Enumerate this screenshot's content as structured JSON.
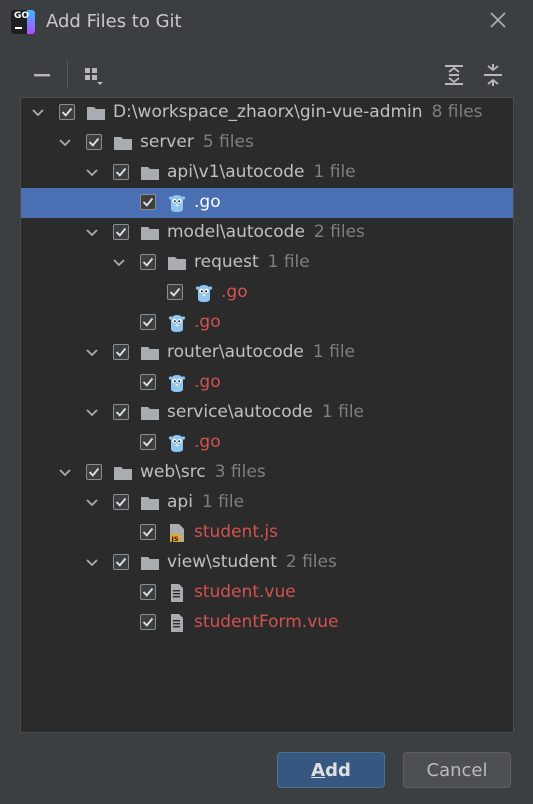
{
  "window": {
    "title": "Add Files to Git"
  },
  "tree": {
    "rows": [
      {
        "name": "D:\\workspace_zhaorx\\gin-vue-admin",
        "count": "8 files"
      },
      {
        "name": "server",
        "count": "5 files"
      },
      {
        "name": "api\\v1\\autocode",
        "count": "1 file"
      },
      {
        "name": ".go",
        "count": ""
      },
      {
        "name": "model\\autocode",
        "count": "2 files"
      },
      {
        "name": "request",
        "count": "1 file"
      },
      {
        "name": ".go",
        "count": ""
      },
      {
        "name": ".go",
        "count": ""
      },
      {
        "name": "router\\autocode",
        "count": "1 file"
      },
      {
        "name": ".go",
        "count": ""
      },
      {
        "name": "service\\autocode",
        "count": "1 file"
      },
      {
        "name": ".go",
        "count": ""
      },
      {
        "name": "web\\src",
        "count": "3 files"
      },
      {
        "name": "api",
        "count": "1 file"
      },
      {
        "name": "student.js",
        "count": ""
      },
      {
        "name": "view\\student",
        "count": "2 files"
      },
      {
        "name": "student.vue",
        "count": ""
      },
      {
        "name": "studentForm.vue",
        "count": ""
      }
    ]
  },
  "buttons": {
    "add_mnemonic": "A",
    "add_rest": "dd",
    "cancel": "Cancel"
  },
  "colors": {
    "accent": "#4a6fb3",
    "new_file": "#d25252",
    "primary_button": "#365880"
  }
}
